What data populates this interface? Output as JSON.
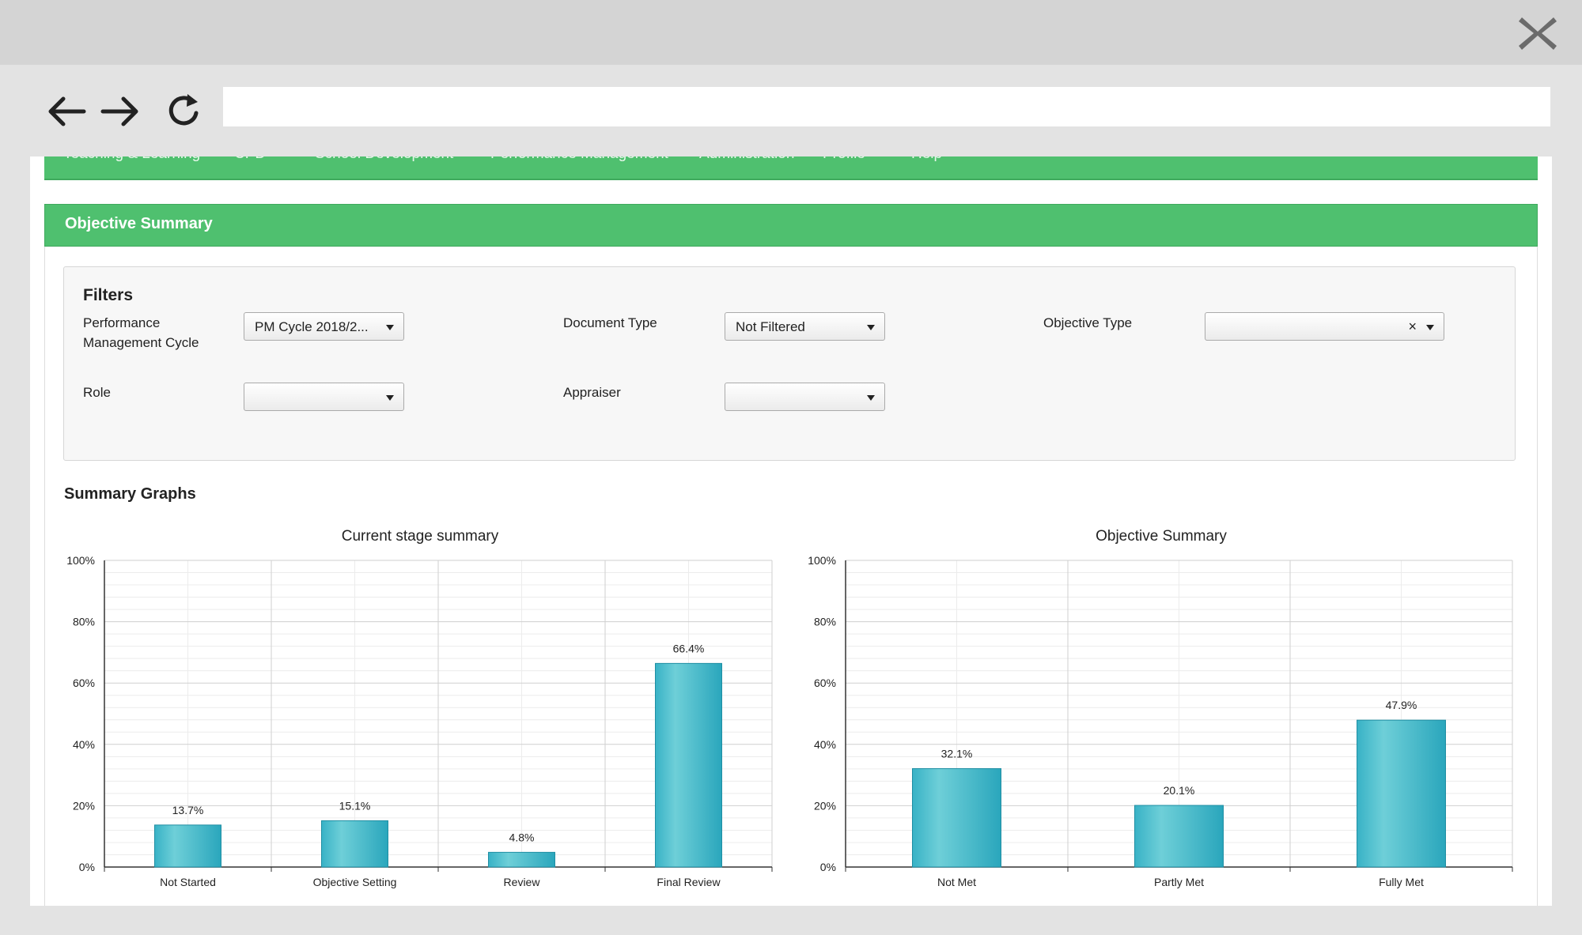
{
  "browser": {
    "close_icon": "close-x-icon",
    "back_icon": "arrow-left-icon",
    "forward_icon": "arrow-right-icon",
    "reload_icon": "reload-icon",
    "url_value": ""
  },
  "topnav": {
    "items": [
      "Teaching & Learning",
      "CPD",
      "School Development",
      "Performance Management",
      "Administration",
      "Profile",
      "Help"
    ]
  },
  "panel": {
    "title": "Objective Summary"
  },
  "filters": {
    "title": "Filters",
    "cycle": {
      "label": "Performance Management Cycle",
      "value": "PM Cycle 2018/2..."
    },
    "document_type": {
      "label": "Document Type",
      "value": "Not Filtered"
    },
    "objective_type": {
      "label": "Objective Type",
      "value": "",
      "clear": "×"
    },
    "role": {
      "label": "Role",
      "value": ""
    },
    "appraiser": {
      "label": "Appraiser",
      "value": ""
    }
  },
  "summary_graphs": {
    "title": "Summary Graphs"
  },
  "colors": {
    "green": "#4fc06f",
    "bar_light": "#6ecfd8",
    "bar_dark": "#2aa6bc",
    "bar_border": "#1f8ea3"
  },
  "chart_data": [
    {
      "type": "bar",
      "title": "Current stage summary",
      "categories": [
        "Not Started",
        "Objective Setting",
        "Review",
        "Final Review"
      ],
      "values": [
        13.7,
        15.1,
        4.8,
        66.4
      ],
      "value_labels": [
        "13.7%",
        "15.1%",
        "4.8%",
        "66.4%"
      ],
      "ylim": [
        0,
        100
      ],
      "yticks": [
        "0%",
        "20%",
        "40%",
        "60%",
        "80%",
        "100%"
      ],
      "grid": true
    },
    {
      "type": "bar",
      "title": "Objective Summary",
      "categories": [
        "Not Met",
        "Partly Met",
        "Fully Met"
      ],
      "values": [
        32.1,
        20.1,
        47.9
      ],
      "value_labels": [
        "32.1%",
        "20.1%",
        "47.9%"
      ],
      "ylim": [
        0,
        100
      ],
      "yticks": [
        "0%",
        "20%",
        "40%",
        "60%",
        "80%",
        "100%"
      ],
      "grid": true
    }
  ]
}
